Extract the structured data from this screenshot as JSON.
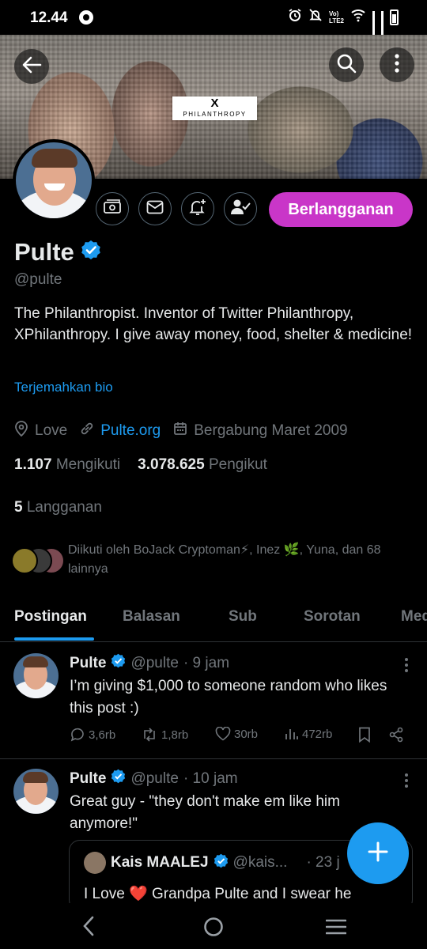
{
  "status_bar": {
    "time": "12.44",
    "network_label": "Vo) LTE2",
    "network_label_line1": "Vo)",
    "network_label_line2": "LTE2"
  },
  "banner": {
    "logo_x": "X",
    "logo_text": "PHILANTHROPY"
  },
  "profile": {
    "name": "Pulte",
    "handle": "@pulte",
    "bio": "The Philanthropist. Inventor of Twitter Philanthropy, XPhilanthropy. I give away money, food, shelter & medicine!",
    "translate_label": "Terjemahkan bio",
    "location": "Love",
    "website": "Pulte.org",
    "joined": "Bergabung Maret 2009",
    "following_count": "1.107",
    "following_label": "Mengikuti",
    "followers_count": "3.078.625",
    "followers_label": "Pengikut",
    "subscriptions_count": "5",
    "subscriptions_label": "Langganan",
    "followed_by": "Diikuti oleh BoJack Cryptoman⚡, Inez 🌿, Yuna, dan 68 lainnya",
    "subscribe_button": "Berlangganan",
    "verified_color": "#1d9bf0",
    "accent_color": "#c936c8"
  },
  "tabs": [
    {
      "label": "Postingan",
      "active": true
    },
    {
      "label": "Balasan",
      "active": false
    },
    {
      "label": "Sub",
      "active": false
    },
    {
      "label": "Sorotan",
      "active": false
    },
    {
      "label": "Media",
      "active": false
    }
  ],
  "posts": [
    {
      "author": "Pulte",
      "handle": "@pulte",
      "time": "· 9 jam",
      "text": "I’m giving $1,000 to someone random who likes this post :)",
      "replies": "3,6rb",
      "reposts": "1,8rb",
      "likes": "30rb",
      "views": "472rb"
    },
    {
      "author": "Pulte",
      "handle": "@pulte",
      "time": "· 10 jam",
      "text": "Great guy - \"they don't make em like him anymore!\"",
      "quote": {
        "author": "Kais MAALEJ",
        "handle": "@kais...",
        "time": "· 23 j",
        "text": "I Love ❤️ Grandpa Pulte and I swear he"
      }
    }
  ],
  "icons": {
    "back": "arrow-left-icon",
    "search": "search-icon",
    "more": "more-vertical-icon",
    "fab": "plus-icon"
  }
}
